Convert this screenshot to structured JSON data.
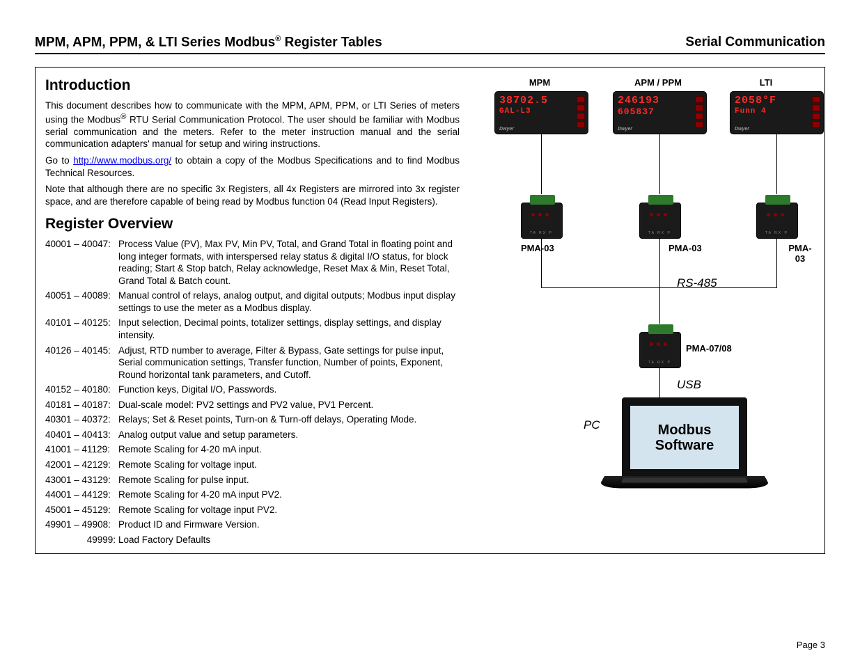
{
  "header": {
    "title_a": "MPM, APM, PPM, & LTI Series Modbus",
    "title_b": " Register Tables",
    "reg_mark": "®",
    "section": "Serial Communication"
  },
  "intro": {
    "heading": "Introduction",
    "p1a": "This document describes how to communicate with the MPM, APM, PPM, or LTI Series of meters using the Modbus",
    "reg_mark": "®",
    "p1b": " RTU Serial Communication Protocol. The user should be familiar with Modbus serial communication and the meters. Refer to the meter instruction manual and the serial communication adapters' manual for setup and wiring instructions.",
    "p2a": "Go to ",
    "link": "http://www.modbus.org/",
    "p2b": " to obtain a copy of the Modbus Specifications and to find Modbus Technical Resources.",
    "p3": "Note that although there are no specific 3x Registers, all 4x Registers are mirrored into 3x register space, and are therefore capable of being read by Modbus function 04 (Read Input Registers)."
  },
  "overview": {
    "heading": "Register Overview",
    "rows": [
      {
        "range": "40001 – 40047:",
        "desc": "Process Value (PV), Max PV, Min PV, Total, and Grand Total in floating point and long integer formats, with interspersed relay status & digital I/O status, for block reading; Start & Stop batch, Relay acknowledge, Reset Max & Min, Reset Total, Grand Total & Batch count."
      },
      {
        "range": "40051 – 40089:",
        "desc": "Manual control of relays, analog output, and digital outputs; Modbus input display settings to use the meter as a Modbus display."
      },
      {
        "range": "40101 – 40125:",
        "desc": "Input selection, Decimal points, totalizer settings, display settings, and display intensity."
      },
      {
        "range": "40126 – 40145:",
        "desc": "Adjust, RTD number to average, Filter & Bypass, Gate settings for pulse input, Serial communication settings, Transfer function, Number of points, Exponent, Round horizontal tank parameters, and Cutoff."
      },
      {
        "range": "40152 – 40180:",
        "desc": "Function keys, Digital I/O, Passwords."
      },
      {
        "range": "40181 – 40187:",
        "desc": "Dual-scale model: PV2 settings and PV2 value, PV1 Percent."
      },
      {
        "range": "40301 – 40372:",
        "desc": "Relays; Set & Reset points, Turn-on & Turn-off delays, Operating Mode."
      },
      {
        "range": "40401 – 40413:",
        "desc": "Analog output value and setup parameters."
      },
      {
        "range": "41001 – 41129:",
        "desc": "Remote Scaling for 4-20 mA input."
      },
      {
        "range": "42001 – 42129:",
        "desc": "Remote Scaling for voltage input."
      },
      {
        "range": "43001 – 43129:",
        "desc": "Remote Scaling for pulse input."
      },
      {
        "range": "44001 – 44129:",
        "desc": "Remote Scaling for 4-20 mA input PV2."
      },
      {
        "range": "45001 – 45129:",
        "desc": "Remote Scaling for voltage input PV2."
      },
      {
        "range": "49901 – 49908:",
        "desc": "Product ID and Firmware Version."
      },
      {
        "range": "49999:",
        "desc": "Load Factory Defaults",
        "indent": true
      }
    ]
  },
  "diagram": {
    "labels": {
      "mpm": "MPM",
      "apm": "APM / PPM",
      "lti": "LTI",
      "pma03": "PMA-03",
      "pma0708": "PMA-07/08",
      "rs485": "RS-485",
      "usb": "USB",
      "pc": "PC",
      "modbus_sw_1": "Modbus",
      "modbus_sw_2": "Software"
    },
    "meter_mpm_line1": "38702.5",
    "meter_mpm_line2": "GAL-L3",
    "meter_apm_line1": "246193",
    "meter_apm_line2": "605837",
    "meter_lti_line1": "2058°F",
    "meter_lti_line2": "Funn 4"
  },
  "footer": {
    "page": "Page 3"
  }
}
